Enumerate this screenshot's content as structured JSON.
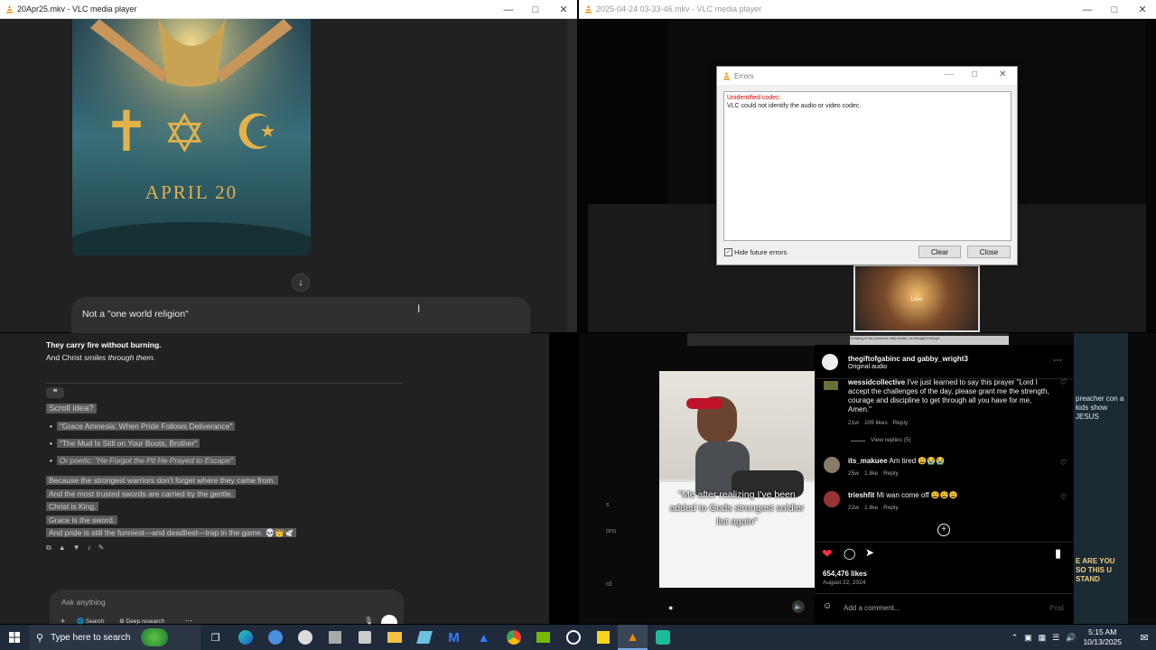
{
  "left_window": {
    "title": "20Apr25.mkv - VLC media player",
    "image_text": "APRIL 20",
    "prompt_bubble": "Not a \"one world religion\"",
    "chat": {
      "bold_line": "They carry fire without burning.",
      "line2_prefix": "And Christ ",
      "line2_italic": "smiles through them.",
      "quote_icon": "❝",
      "scroll_title": "Scroll idea?",
      "bullets": [
        "\"Grace Amnesia: When Pride Follows Deliverance\"",
        "\"The Mud Is Still on Your Boots, Brother\"",
        "Or poetic: \"He Forgot the Pit He Prayed to Escape\""
      ],
      "body_lines": [
        "Because the strongest warriors don't forget where they came from.",
        "And the most trusted swords are carried by the gentle.",
        "Christ is King.",
        "Grace is the sword.",
        "And pride is still the funniest—and deadliest—trap in the game. 💀👑🕊️"
      ],
      "input_placeholder": "Ask anything",
      "search_label": "Search",
      "deep_research_label": "Deep research"
    }
  },
  "right_window": {
    "title": "2025-04-24 03-33-46.mkv - VLC media player",
    "errors_dialog": {
      "title": "Errors",
      "error_heading": "Unidentified codec:",
      "error_text": "VLC could not identify the audio or video codec.",
      "hide_label": "Hide future errors",
      "clear_label": "Clear",
      "close_label": "Close"
    },
    "thumb_caption": "Love",
    "small_caption": "Growing in his presence with leader, he thought through",
    "side_texts": [
      "s",
      "ons",
      "rd"
    ],
    "right_banner": "preacher con a kids show JESUS",
    "right_banner2": "E ARE YOU SO THIS U STAND"
  },
  "instagram": {
    "account": "thegiftofgabinc and gabby_wright3",
    "audio": "Original audio",
    "video_caption": "\"Me after realizing I've been added to Gods strongest soldier list again\"",
    "comments": [
      {
        "user": "wessidcollective",
        "text": "I've just learned to say this prayer \"Lord I accept the challenges of the day, please grant me the strength, courage and discipline to get through all you have for me, Amen.\"",
        "age": "21w",
        "likes": "109 likes",
        "reply": "Reply"
      },
      {
        "user": "its_makuee",
        "text": "Am tired 😩😭😭",
        "age": "25w",
        "likes": "1 like",
        "reply": "Reply"
      },
      {
        "user": "trieshfit",
        "text": "Mi wan come off 😩😩😩",
        "age": "22w",
        "likes": "1 like",
        "reply": "Reply"
      }
    ],
    "view_replies": "View replies (5)",
    "likes_count": "654,476 likes",
    "date": "August 22, 2024",
    "comment_placeholder": "Add a comment...",
    "post_label": "Post"
  },
  "taskbar": {
    "search_placeholder": "Type here to search",
    "time": "5:15 AM",
    "date": "10/13/2025"
  },
  "colors": {
    "vlc_orange": "#f28c00",
    "error_red": "#d40000",
    "taskbar_bg": "#1f2a3a",
    "like_red": "#ff3040"
  }
}
